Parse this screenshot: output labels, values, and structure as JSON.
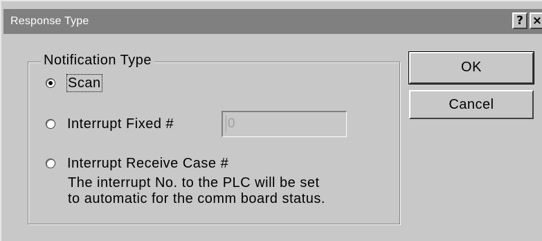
{
  "window": {
    "title": "Response Type",
    "help_glyph": "?",
    "close_glyph": "×"
  },
  "group": {
    "label": "Notification Type",
    "options": [
      {
        "label": "Scan",
        "checked": true
      },
      {
        "label": "Interrupt Fixed #",
        "checked": false
      },
      {
        "label": "Interrupt Receive Case #",
        "checked": false
      }
    ],
    "note_line1": "The interrupt No. to the PLC will be set",
    "note_line2": "to automatic for the comm board status."
  },
  "fixed_number": {
    "value": "0",
    "enabled": false
  },
  "buttons": {
    "ok": "OK",
    "cancel": "Cancel"
  },
  "colors": {
    "dialog_bg": "#c8c8c8",
    "titlebar_bg": "#808080",
    "disabled_text": "#a0a0a0"
  }
}
